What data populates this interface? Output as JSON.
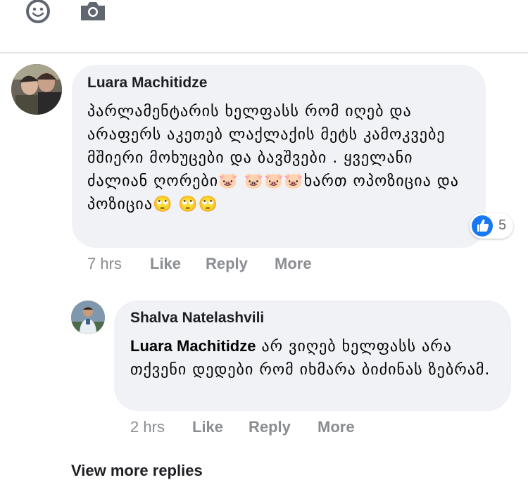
{
  "composer": {
    "emoji_icon": "smiley-face-icon",
    "camera_icon": "camera-icon"
  },
  "comments": [
    {
      "author": "Luara Machitidze",
      "text": "პარლამენტარის ხელფასს რომ იღებ და არაფერს აკეთებ ლაქლაქის მეტს კამოკვებე მშიერი მოხუცები და ბავშვები . ყველანი ძალიან ღორები🐷 🐷🐷🐷ხართ ოპოზიცია და პოზიცია🙄 🙄🙄",
      "time": "7 hrs",
      "actions": [
        "Like",
        "Reply",
        "More"
      ],
      "reaction_count": "5",
      "reaction_icon": "thumbs-up-icon"
    },
    {
      "author": "Shalva Natelashvili",
      "mention": "Luara Machitidze",
      "text": "არ ვიღებ ხელფასს არა თქვენი დედები რომ იხმარა ბიძინას ზებრამ.",
      "time": "2 hrs",
      "actions": [
        "Like",
        "Reply",
        "More"
      ]
    }
  ],
  "footer": {
    "view_more": "View more replies"
  },
  "colors": {
    "bubble": "#f0f2f5",
    "meta_text": "#8a8d91",
    "like_blue": "#1877f2",
    "divider": "#e4e6eb"
  }
}
